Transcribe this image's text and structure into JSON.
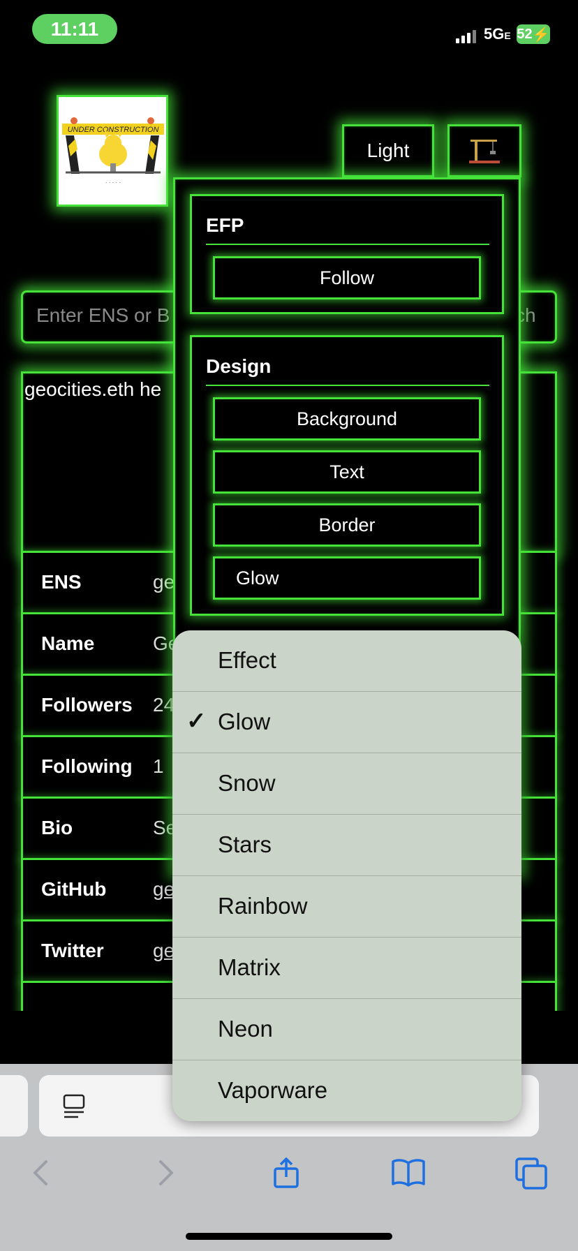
{
  "status": {
    "time": "11:11",
    "network": "5G",
    "network_suffix": "E",
    "battery": "52"
  },
  "header": {
    "theme_button": "Light",
    "crane_icon": "crane-icon",
    "logo_text": "UNDER CONSTRUCTION"
  },
  "search": {
    "placeholder": "Enter ENS or B",
    "button_fragment": "ch"
  },
  "profile": {
    "hello_text": "geocities.eth he",
    "rows": [
      {
        "key": "ENS",
        "value": "ge",
        "link": false
      },
      {
        "key": "Name",
        "value": "Ge",
        "link": false
      },
      {
        "key": "Followers",
        "value": "24",
        "link": false
      },
      {
        "key": "Following",
        "value": "1",
        "link": false
      },
      {
        "key": "Bio",
        "value": "Se",
        "link": false
      },
      {
        "key": "GitHub",
        "value": "ge",
        "link": true
      },
      {
        "key": "Twitter",
        "value": "ge",
        "link": true
      }
    ]
  },
  "settings": {
    "efp": {
      "title": "EFP",
      "follow": "Follow"
    },
    "design": {
      "title": "Design",
      "background": "Background",
      "text": "Text",
      "border": "Border",
      "effect_select": "Glow"
    }
  },
  "effect_menu": {
    "options": [
      "Effect",
      "Glow",
      "Snow",
      "Stars",
      "Rainbow",
      "Matrix",
      "Neon",
      "Vaporware"
    ],
    "selected": "Glow",
    "check": "✓"
  },
  "colors": {
    "accent": "#46e23a",
    "menu_bg": "#cbd4c8",
    "status_green": "#5ecf61"
  }
}
